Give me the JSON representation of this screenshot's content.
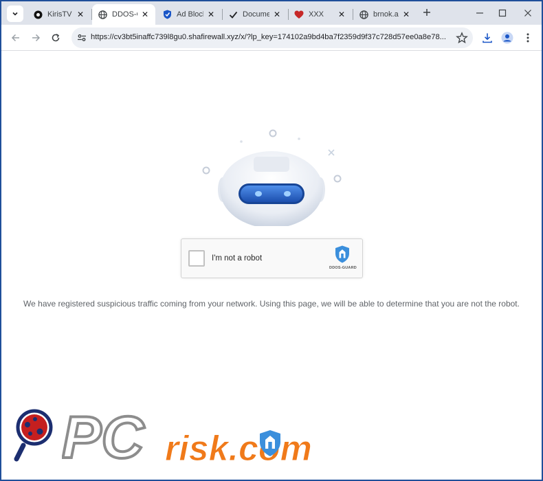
{
  "browser": {
    "tabs": [
      {
        "title": "KirisTV –",
        "favicon": "circle-logo-icon"
      },
      {
        "title": "DDOS-G",
        "favicon": "globe-icon",
        "active": true
      },
      {
        "title": "Ad Block",
        "favicon": "shield-icon"
      },
      {
        "title": "Documen",
        "favicon": "checkmark-icon"
      },
      {
        "title": "XXX",
        "favicon": "heart-icon"
      },
      {
        "title": "brnok.ac",
        "favicon": "globe-icon"
      }
    ],
    "url": "https://cv3bt5inaffc739l8gu0.shafirewall.xyz/x/?lp_key=174102a9bd4ba7f2359d9f37c728d57ee0a8e78..."
  },
  "captcha": {
    "label": "I'm not a robot",
    "brand": "DDOS-GUARD"
  },
  "message": "We have registered suspicious traffic coming from your network. Using this page, we will be able to determine that you are not the robot.",
  "watermark": {
    "pc_text": "PC",
    "risk_text": "risk.com"
  },
  "colors": {
    "tabstrip": "#dfe3eb",
    "accent_blue": "#3b8fdc",
    "robot_eye": "#2f6fd6",
    "watermark_orange": "#f07a1a",
    "watermark_gray": "#8d8d8d"
  }
}
